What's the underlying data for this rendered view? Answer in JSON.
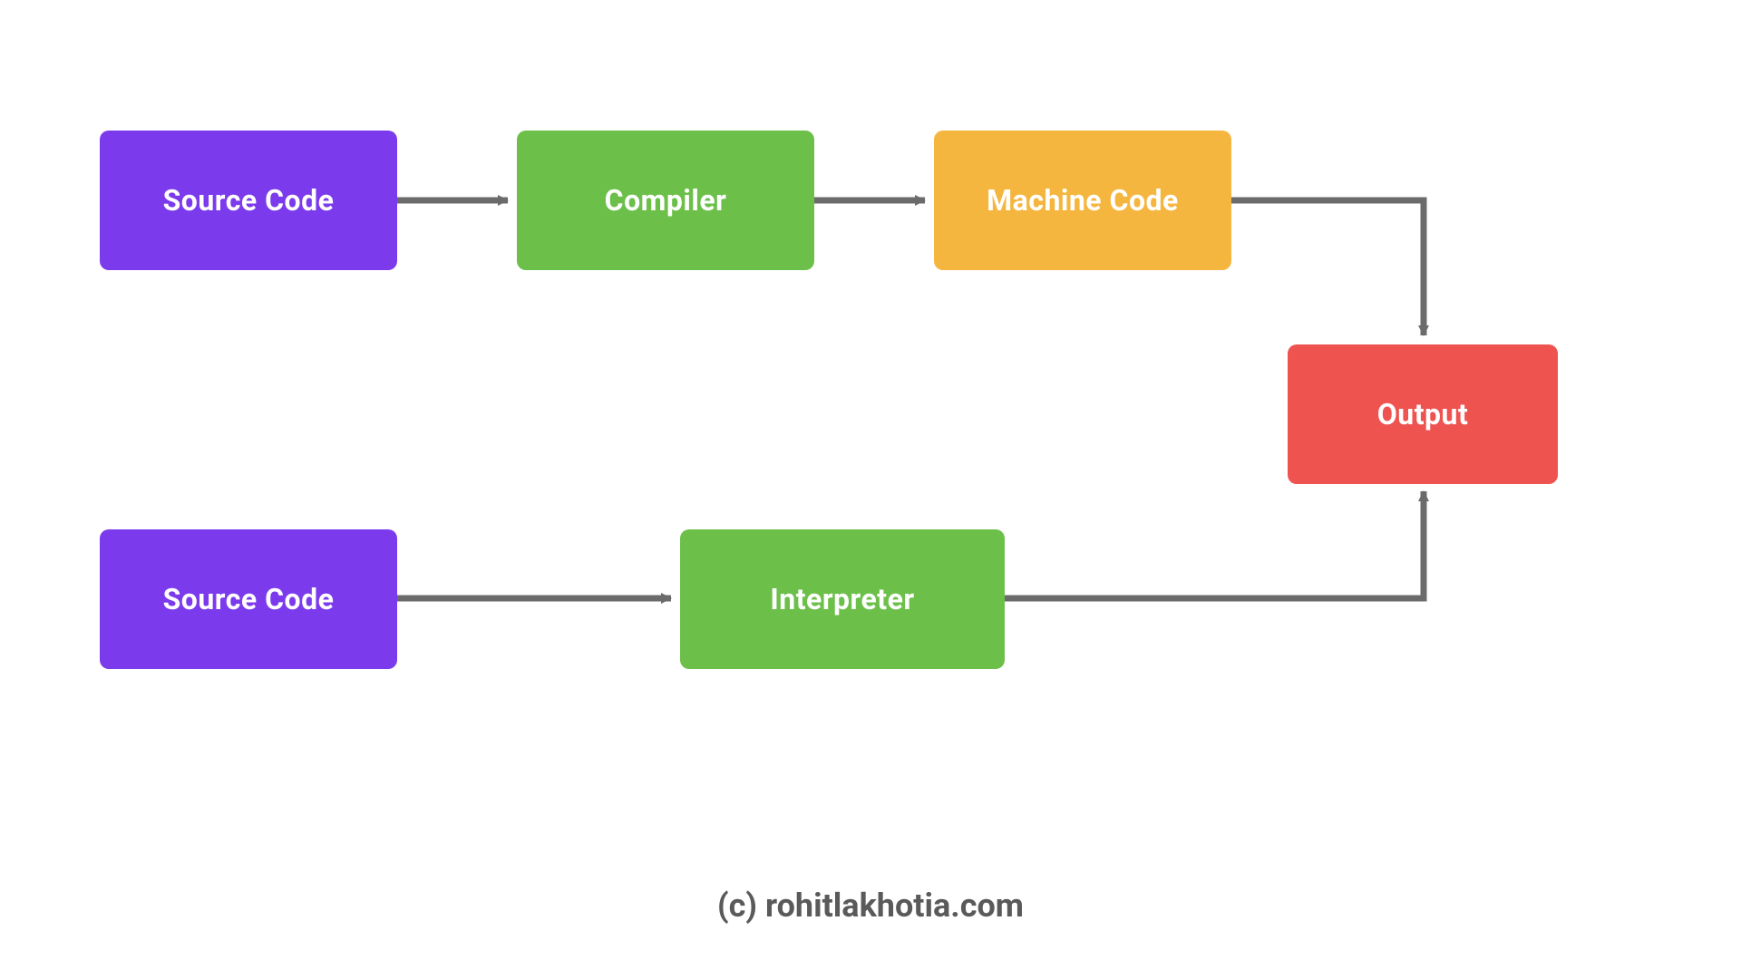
{
  "nodes": {
    "source_code_1": {
      "label": "Source Code"
    },
    "compiler": {
      "label": "Compiler"
    },
    "machine_code": {
      "label": "Machine Code"
    },
    "output": {
      "label": "Output"
    },
    "source_code_2": {
      "label": "Source Code"
    },
    "interpreter": {
      "label": "Interpreter"
    }
  },
  "attribution": "(c) rohitlakhotia.com",
  "colors": {
    "purple": "#7C3AED",
    "green": "#6CC04A",
    "orange": "#F5B63F",
    "red": "#EF5350",
    "arrow": "#6B6B6B"
  }
}
